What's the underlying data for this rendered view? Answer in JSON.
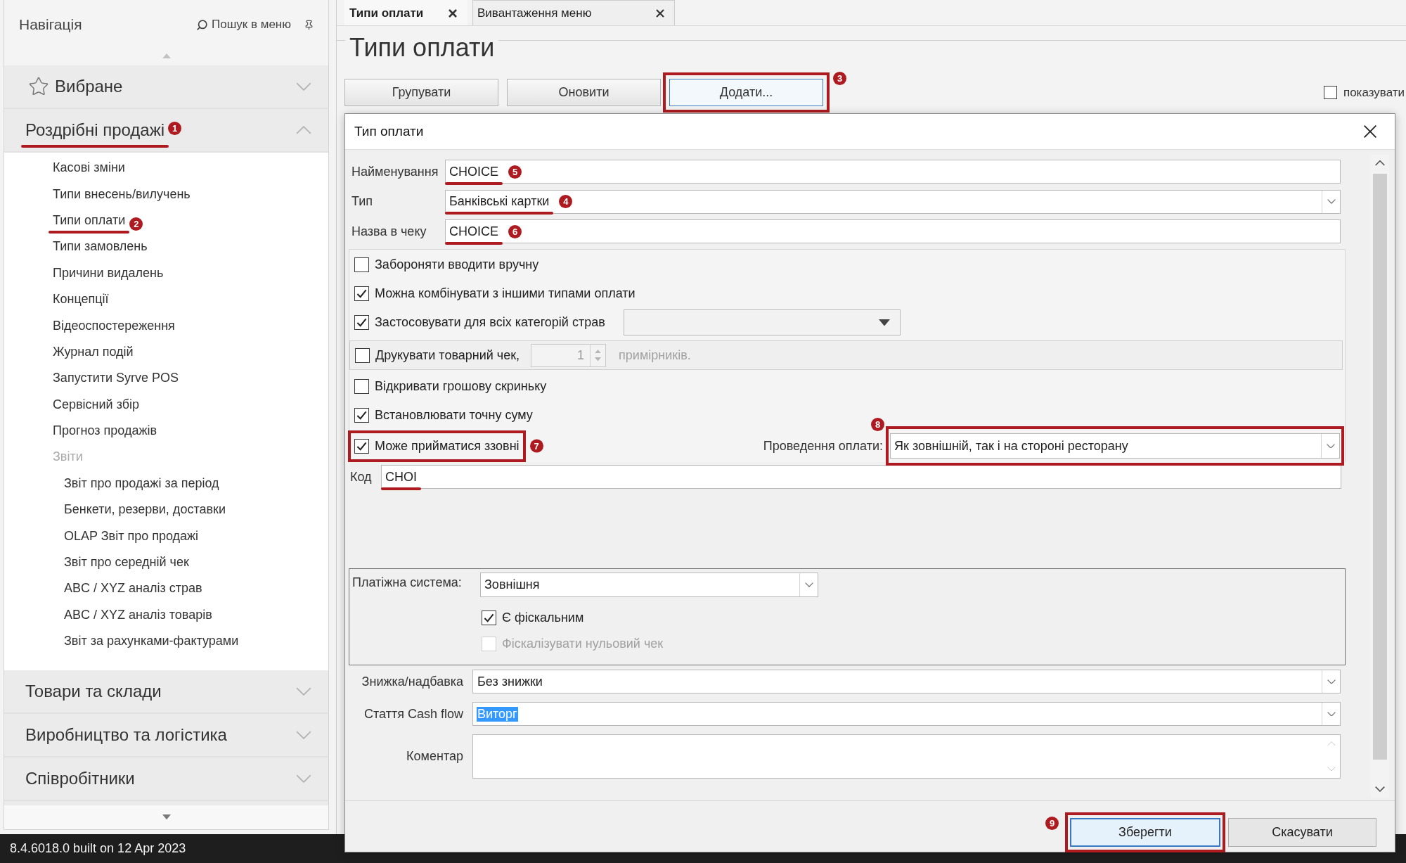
{
  "sidebar": {
    "title": "Навігація",
    "search_label": "Пошук в меню",
    "sections": [
      {
        "kind": "favorites",
        "label": "Вибране",
        "expanded": false,
        "underlined": false
      },
      {
        "kind": "plain",
        "label": "Роздрібні продажі",
        "expanded": true,
        "underlined": true,
        "badge": "1",
        "items": [
          {
            "label": "Касові зміни",
            "underlined": false
          },
          {
            "label": "Типи внесень/вилучень",
            "underlined": false
          },
          {
            "label": "Типи оплати",
            "underlined": true,
            "badge": "2"
          },
          {
            "label": "Типи замовлень",
            "underlined": false
          },
          {
            "label": "Причини видалень",
            "underlined": false
          },
          {
            "label": "Концепції",
            "underlined": false
          },
          {
            "label": "Відеоспостереження",
            "underlined": false
          },
          {
            "label": "Журнал подій",
            "underlined": false
          },
          {
            "label": "Запустити Syrve POS",
            "underlined": false
          },
          {
            "label": "Сервісний збір",
            "underlined": false
          },
          {
            "label": "Прогноз продажів",
            "underlined": false
          },
          {
            "label": "Звіти",
            "underlined": false,
            "children": [
              {
                "label": "Звіт про продажі за період",
                "underlined": false
              },
              {
                "label": "Бенкети, резерви, доставки",
                "underlined": false
              },
              {
                "label": "OLAP Звіт про продажі",
                "underlined": false
              },
              {
                "label": "Звіт про середній чек",
                "underlined": false
              },
              {
                "label": "ABC / XYZ аналіз страв",
                "underlined": false
              },
              {
                "label": "ABC / XYZ аналіз товарів",
                "underlined": false
              },
              {
                "label": "Звіт за рахунками-фактурами",
                "underlined": false
              }
            ]
          }
        ]
      },
      {
        "kind": "plain",
        "label": "Товари та склади",
        "expanded": false,
        "underlined": false
      },
      {
        "kind": "plain",
        "label": "Виробництво та логістика",
        "expanded": false,
        "underlined": false
      },
      {
        "kind": "plain",
        "label": "Співробітники",
        "expanded": false,
        "underlined": false
      }
    ]
  },
  "tabs": [
    {
      "label": "Типи оплати",
      "selected": true
    },
    {
      "label": "Вивантаження меню",
      "selected": false
    }
  ],
  "page": {
    "title": "Типи оплати",
    "toolbar": [
      {
        "label": "Групувати",
        "focused": false,
        "boxed": false
      },
      {
        "label": "Оновити",
        "focused": false,
        "boxed": false
      },
      {
        "label": "Додати...",
        "focused": true,
        "boxed": true,
        "badge": "3"
      }
    ],
    "show_option": {
      "label": "показувати",
      "checked": false
    }
  },
  "dialog": {
    "title": "Тип оплати",
    "fields": [
      {
        "kind": "text",
        "label": "Найменування",
        "value": "CHOICE",
        "underlined": true,
        "badge": "5"
      },
      {
        "kind": "select",
        "label": "Тип",
        "value": "Банківські картки",
        "underlined": true,
        "badge": "4"
      },
      {
        "kind": "text",
        "label": "Назва в чеку",
        "value": "CHOICE",
        "underlined": true,
        "badge": "6"
      }
    ],
    "options": [
      {
        "kind": "check",
        "label": "Забороняти вводити вручну",
        "checked": false
      },
      {
        "kind": "check",
        "label": "Можна комбінувати з іншими типами оплати",
        "checked": true
      },
      {
        "kind": "check_select",
        "label": "Застосовувати для всіх категорій страв",
        "checked": true
      },
      {
        "kind": "check_spin",
        "label": "Друкувати товарний чек,",
        "checked": false,
        "value": "1",
        "suffix": "примірників."
      },
      {
        "kind": "check",
        "label": "Відкривати грошову скриньку",
        "checked": false
      },
      {
        "kind": "check",
        "label": "Встановлювати точну суму",
        "checked": true
      }
    ],
    "external": {
      "label": "Може прийматися ззовні",
      "checked": true,
      "boxed": true,
      "badge": "7",
      "mode_label": "Проведення оплати:",
      "mode_value": "Як зовнішній, так і на стороні ресторану",
      "mode_boxed": true,
      "mode_badge": "8"
    },
    "code": {
      "label": "Код",
      "value": "CHOI",
      "underlined": true
    },
    "payment_system": {
      "label": "Платіжна система:",
      "value": "Зовнішня",
      "checks": [
        {
          "label": "Є фіскальним",
          "checked": true,
          "disabled": false
        },
        {
          "label": "Фіскалізувати нульовий чек",
          "checked": false,
          "disabled": true
        }
      ]
    },
    "extra_fields": [
      {
        "kind": "select",
        "label": "Знижка/надбавка",
        "value": "Без знижки",
        "highlighted": false
      },
      {
        "kind": "select",
        "label": "Стаття Cash flow",
        "value": "Виторг",
        "highlighted": true
      },
      {
        "kind": "textarea",
        "label": "Коментар"
      }
    ],
    "buttons": [
      {
        "label": "Зберегти",
        "focused": true,
        "boxed": true,
        "badge": "9"
      },
      {
        "label": "Скасувати",
        "focused": false,
        "boxed": false
      }
    ]
  },
  "status_bar": {
    "version": "8.4.6018.0 built on 12 Apr 2023"
  }
}
